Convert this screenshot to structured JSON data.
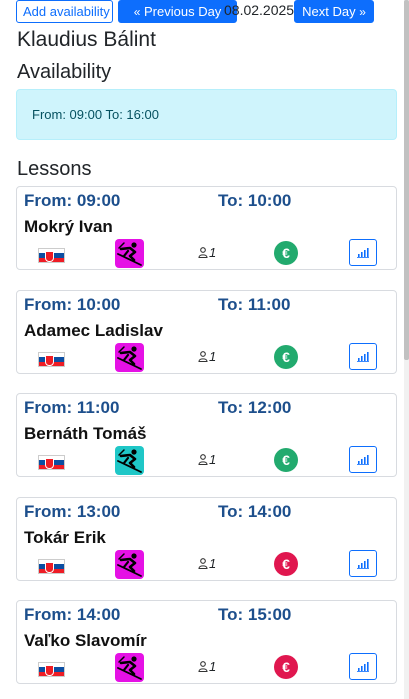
{
  "toolbar": {
    "add_availability_label": "Add availability",
    "previous_day_label": "Previous Day",
    "previous_day_icon": "chevrons-left-icon",
    "date": "08.02.2025",
    "next_day_label": "Next Day",
    "next_day_icon": "chevrons-right-icon"
  },
  "instructor_name": "Klaudius Bálint",
  "availability": {
    "title": "Availability",
    "text": "From: 09:00 To: 16:00"
  },
  "lessons": {
    "title": "Lessons",
    "items": [
      {
        "from": "From: 09:00",
        "to": "To: 10:00",
        "student": "Mokrý Ivan",
        "flag": "slovakia-flag",
        "sport": "ski",
        "sport_color": "#e511e5",
        "persons": "1",
        "payment_status": "paid",
        "payment_color": "#22aa6e",
        "payment_icon": "€"
      },
      {
        "from": "From: 10:00",
        "to": "To: 11:00",
        "student": "Adamec Ladislav",
        "flag": "slovakia-flag",
        "sport": "ski",
        "sport_color": "#e511e5",
        "persons": "1",
        "payment_status": "paid",
        "payment_color": "#22aa6e",
        "payment_icon": "€"
      },
      {
        "from": "From: 11:00",
        "to": "To: 12:00",
        "student": "Bernáth Tomáš",
        "flag": "slovakia-flag",
        "sport": "ski",
        "sport_color": "#1fc7c7",
        "persons": "1",
        "payment_status": "paid",
        "payment_color": "#22aa6e",
        "payment_icon": "€"
      },
      {
        "from": "From: 13:00",
        "to": "To: 14:00",
        "student": "Tokár Erik",
        "flag": "slovakia-flag",
        "sport": "ski",
        "sport_color": "#e511e5",
        "persons": "1",
        "payment_status": "unpaid",
        "payment_color": "#e0174f",
        "payment_icon": "€"
      },
      {
        "from": "From: 14:00",
        "to": "To: 15:00",
        "student": "Vaľko Slavomír",
        "flag": "slovakia-flag",
        "sport": "ski",
        "sport_color": "#e511e5",
        "persons": "1",
        "payment_status": "unpaid",
        "payment_color": "#e0174f",
        "payment_icon": "€"
      }
    ]
  },
  "colors": {
    "primary": "#0d6efd",
    "heading": "#1d4f8c",
    "alert_bg": "#cff4fc",
    "alert_text": "#055160"
  }
}
